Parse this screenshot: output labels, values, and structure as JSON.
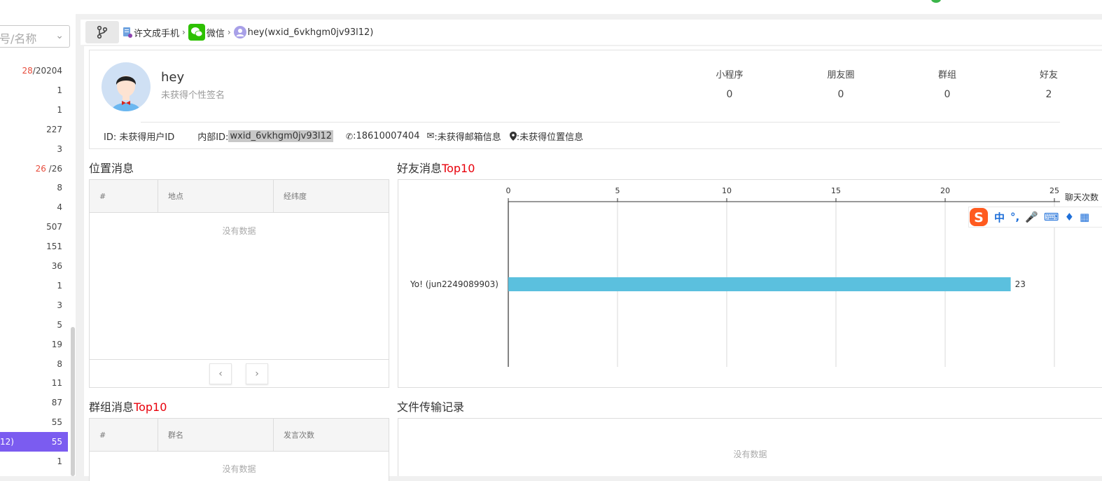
{
  "sidebar": {
    "search_placeholder": "号/名称",
    "rows": [
      {
        "red": "28",
        "text": "/20204"
      },
      {
        "red": "",
        "text": "1"
      },
      {
        "red": "",
        "text": "1"
      },
      {
        "red": "",
        "text": "227"
      },
      {
        "red": "",
        "text": "3"
      },
      {
        "red": "26",
        "text": " /26"
      },
      {
        "red": "",
        "text": "8"
      },
      {
        "red": "",
        "text": "4"
      },
      {
        "red": "",
        "text": "507"
      },
      {
        "red": "",
        "text": "151"
      },
      {
        "red": "",
        "text": "36"
      },
      {
        "red": "",
        "text": "1"
      },
      {
        "red": "",
        "text": "3"
      },
      {
        "red": "",
        "text": "5"
      },
      {
        "red": "",
        "text": "19"
      },
      {
        "red": "",
        "text": "8"
      },
      {
        "red": "",
        "text": "11"
      },
      {
        "red": "",
        "text": "87"
      },
      {
        "red": "",
        "text": "55"
      },
      {
        "red": "",
        "text": "55",
        "selected": true,
        "tag": "12)"
      },
      {
        "red": "",
        "text": "1"
      }
    ],
    "selected_color": "#7b5cf0"
  },
  "breadcrumb": {
    "items": [
      "许文成手机",
      "微信",
      "hey(wxid_6vkhgm0jv93l12)"
    ],
    "separator": "›"
  },
  "profile": {
    "name": "hey",
    "signature": "未获得个性签名",
    "stats": [
      {
        "label": "小程序",
        "value": "0"
      },
      {
        "label": "朋友圈",
        "value": "0"
      },
      {
        "label": "群组",
        "value": "0"
      },
      {
        "label": "好友",
        "value": "2"
      }
    ],
    "id_label": "ID: 未获得用户ID",
    "internal_id_label": "内部ID:",
    "internal_id_value": "wxid_6vkhgm0jv93l12",
    "phone": ":18610007404",
    "email": ":未获得邮箱信息",
    "location": ":未获得位置信息"
  },
  "location_messages": {
    "title": "位置消息",
    "columns": [
      "#",
      "地点",
      "经纬度"
    ],
    "empty_text": "没有数据",
    "prev_icon": "chevron-left-icon",
    "next_icon": "chevron-right-icon"
  },
  "friend_top10": {
    "title_prefix": "好友消息",
    "title_suffix": "Top10"
  },
  "group_top10": {
    "title_prefix": "群组消息",
    "title_suffix": "Top10",
    "columns": [
      "#",
      "群名",
      "发言次数"
    ],
    "empty_text": "没有数据"
  },
  "file_transfer": {
    "title": "文件传输记录",
    "empty_text": "没有数据"
  },
  "ime_toolbar": {
    "labels": [
      "中",
      "°,"
    ]
  },
  "chart_data": {
    "type": "bar",
    "orientation": "horizontal",
    "categories": [
      "Yo!  (jun2249089903)"
    ],
    "values": [
      23
    ],
    "data_labels": [
      "23"
    ],
    "xlabel": "聊天次数",
    "xlim": [
      0,
      25
    ],
    "xticks": [
      0,
      5,
      10,
      15,
      20,
      25
    ],
    "grid": true,
    "bar_color": "#5bc0de"
  }
}
